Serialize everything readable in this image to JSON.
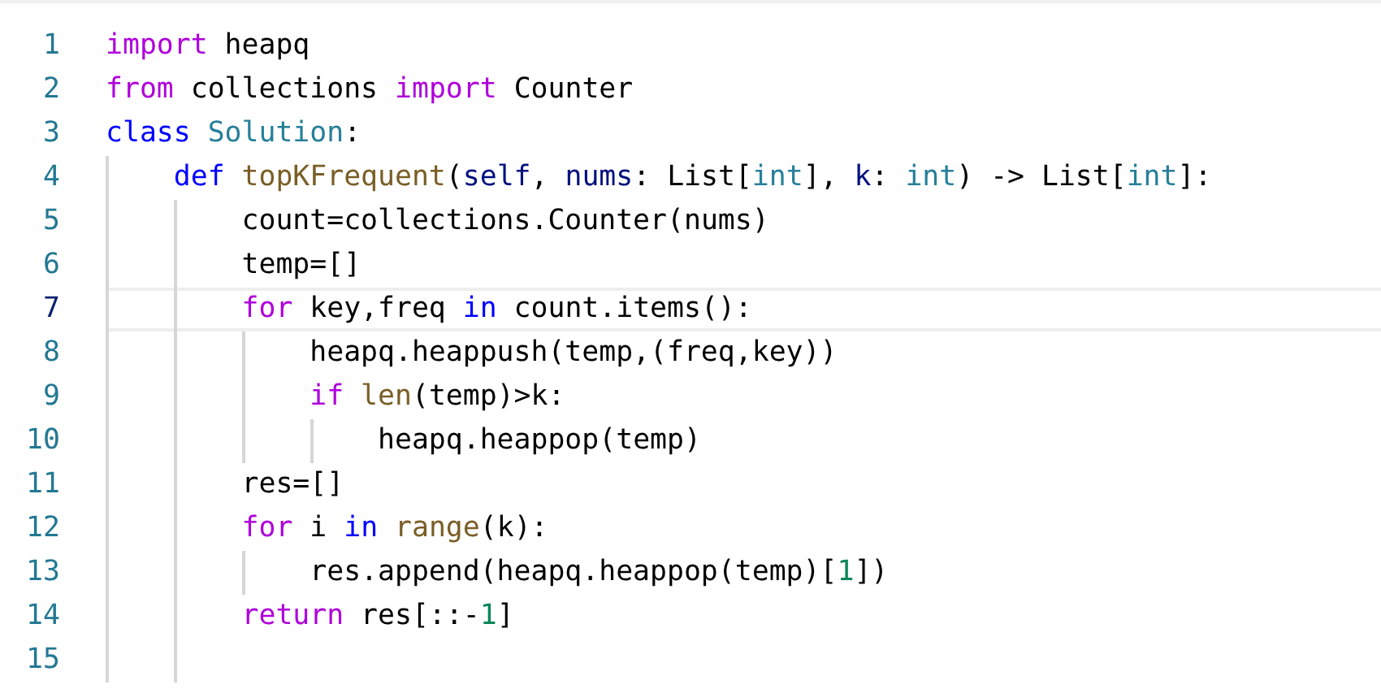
{
  "editor": {
    "lines": [
      {
        "number": "1",
        "current": false,
        "tokens": [
          {
            "kind": "keyword",
            "text": "import"
          },
          {
            "kind": "plain",
            "text": " heapq"
          }
        ]
      },
      {
        "number": "2",
        "current": false,
        "tokens": [
          {
            "kind": "keyword",
            "text": "from"
          },
          {
            "kind": "plain",
            "text": " collections "
          },
          {
            "kind": "keyword",
            "text": "import"
          },
          {
            "kind": "plain",
            "text": " Counter"
          }
        ]
      },
      {
        "number": "3",
        "current": false,
        "tokens": [
          {
            "kind": "storage",
            "text": "class"
          },
          {
            "kind": "type",
            "text": "Solution",
            "gap": true
          },
          {
            "kind": "plain",
            "text": ":"
          }
        ],
        "children": [
          {
            "number": "4",
            "current": false,
            "tokens": [
              {
                "kind": "storage",
                "text": "def"
              },
              {
                "kind": "function",
                "text": "topKFrequent",
                "gap": true
              },
              {
                "kind": "plain",
                "text": "("
              },
              {
                "kind": "param",
                "text": "self"
              },
              {
                "kind": "plain",
                "text": ", "
              },
              {
                "kind": "param",
                "text": "nums"
              },
              {
                "kind": "plain",
                "text": ": List["
              },
              {
                "kind": "type",
                "text": "int"
              },
              {
                "kind": "plain",
                "text": "], "
              },
              {
                "kind": "param",
                "text": "k"
              },
              {
                "kind": "plain",
                "text": ": "
              },
              {
                "kind": "type",
                "text": "int"
              },
              {
                "kind": "plain",
                "text": ") -> List["
              },
              {
                "kind": "type",
                "text": "int"
              },
              {
                "kind": "plain",
                "text": "]:"
              }
            ],
            "children": [
              {
                "number": "5",
                "current": false,
                "tokens": [
                  {
                    "kind": "plain",
                    "text": "count=collections.Counter(nums)"
                  }
                ]
              },
              {
                "number": "6",
                "current": false,
                "tokens": [
                  {
                    "kind": "plain",
                    "text": "temp=[]"
                  }
                ]
              },
              {
                "number": "7",
                "current": true,
                "tokens": [
                  {
                    "kind": "keyword",
                    "text": "for"
                  },
                  {
                    "kind": "plain",
                    "text": " key,freq "
                  },
                  {
                    "kind": "storage",
                    "text": "in"
                  },
                  {
                    "kind": "plain",
                    "text": " count.items():"
                  }
                ],
                "children": [
                  {
                    "number": "8",
                    "current": false,
                    "tokens": [
                      {
                        "kind": "plain",
                        "text": "heapq.heappush(temp,(freq,key))"
                      }
                    ]
                  },
                  {
                    "number": "9",
                    "current": false,
                    "tokens": [
                      {
                        "kind": "keyword",
                        "text": "if"
                      },
                      {
                        "kind": "function",
                        "text": "len",
                        "gap": true
                      },
                      {
                        "kind": "plain",
                        "text": "(temp)>k:"
                      }
                    ],
                    "children": [
                      {
                        "number": "10",
                        "current": false,
                        "tokens": [
                          {
                            "kind": "plain",
                            "text": "heapq.heappop(temp)"
                          }
                        ]
                      }
                    ]
                  }
                ]
              },
              {
                "number": "11",
                "current": false,
                "tokens": [
                  {
                    "kind": "plain",
                    "text": "res=[]"
                  }
                ]
              },
              {
                "number": "12",
                "current": false,
                "tokens": [
                  {
                    "kind": "keyword",
                    "text": "for"
                  },
                  {
                    "kind": "plain",
                    "text": " i "
                  },
                  {
                    "kind": "storage",
                    "text": "in"
                  },
                  {
                    "kind": "function",
                    "text": "range",
                    "gap": true
                  },
                  {
                    "kind": "plain",
                    "text": "(k):"
                  }
                ],
                "children": [
                  {
                    "number": "13",
                    "current": false,
                    "tokens": [
                      {
                        "kind": "plain",
                        "text": "res.append(heapq.heappop(temp)["
                      },
                      {
                        "kind": "number",
                        "text": "1"
                      },
                      {
                        "kind": "plain",
                        "text": "])"
                      }
                    ]
                  }
                ]
              },
              {
                "number": "14",
                "current": false,
                "tokens": [
                  {
                    "kind": "keyword",
                    "text": "return"
                  },
                  {
                    "kind": "plain",
                    "text": " res[::-"
                  },
                  {
                    "kind": "number",
                    "text": "1"
                  },
                  {
                    "kind": "plain",
                    "text": "]"
                  }
                ]
              },
              {
                "number": "15",
                "current": false
              }
            ]
          }
        ]
      }
    ]
  }
}
